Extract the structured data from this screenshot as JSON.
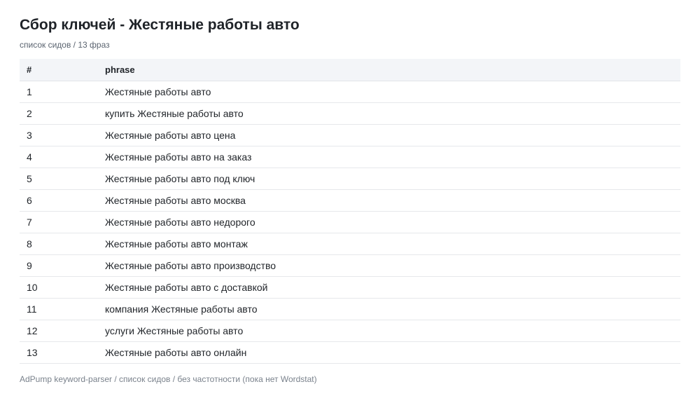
{
  "header": {
    "title": "Сбор ключей - Жестяные работы авто",
    "subtitle": "список сидов / 13 фраз"
  },
  "table": {
    "columns": [
      "#",
      "phrase"
    ],
    "rows": [
      {
        "num": "1",
        "phrase": "Жестяные работы авто"
      },
      {
        "num": "2",
        "phrase": "купить Жестяные работы авто"
      },
      {
        "num": "3",
        "phrase": "Жестяные работы авто цена"
      },
      {
        "num": "4",
        "phrase": "Жестяные работы авто на заказ"
      },
      {
        "num": "5",
        "phrase": "Жестяные работы авто под ключ"
      },
      {
        "num": "6",
        "phrase": "Жестяные работы авто москва"
      },
      {
        "num": "7",
        "phrase": "Жестяные работы авто недорого"
      },
      {
        "num": "8",
        "phrase": "Жестяные работы авто монтаж"
      },
      {
        "num": "9",
        "phrase": "Жестяные работы авто производство"
      },
      {
        "num": "10",
        "phrase": "Жестяные работы авто с доставкой"
      },
      {
        "num": "11",
        "phrase": "компания Жестяные работы авто"
      },
      {
        "num": "12",
        "phrase": "услуги Жестяные работы авто"
      },
      {
        "num": "13",
        "phrase": "Жестяные работы авто онлайн"
      }
    ]
  },
  "footer": {
    "text": "AdPump keyword-parser / список сидов / без частотности (пока нет Wordstat)"
  },
  "colors": {
    "header_bg": "#f3f5f8",
    "row_border": "#e6e8eb",
    "muted_text": "#5b6470"
  }
}
